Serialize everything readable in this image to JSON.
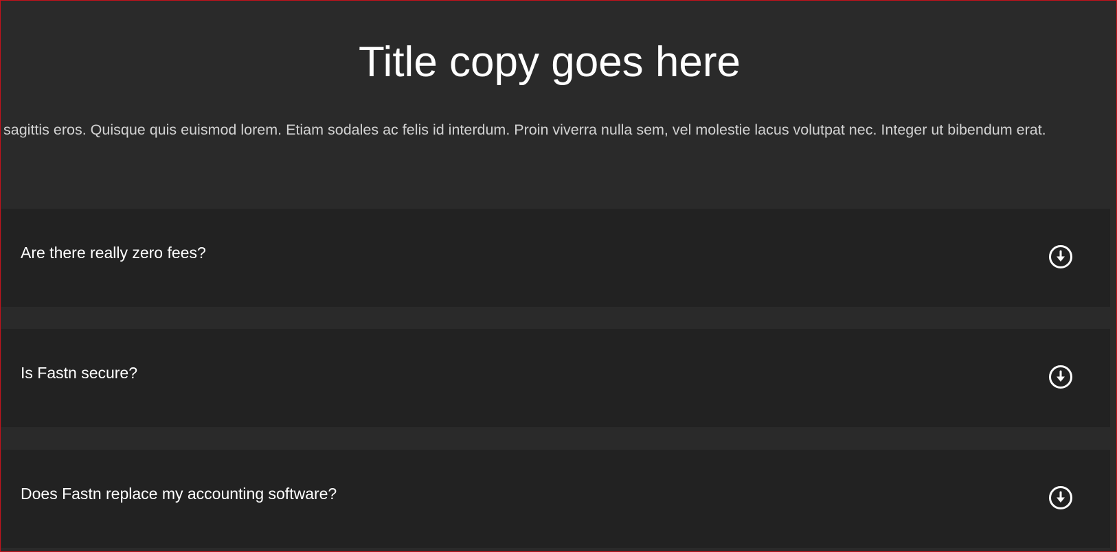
{
  "header": {
    "title": "Title copy goes here",
    "intro": "sagittis eros. Quisque quis euismod lorem. Etiam sodales ac felis id interdum. Proin viverra nulla sem, vel molestie lacus volutpat nec. Integer ut bibendum erat."
  },
  "faq": {
    "items": [
      {
        "question": "Are there really zero fees?",
        "icon": "arrow-down-circle-icon"
      },
      {
        "question": "Is Fastn secure?",
        "icon": "arrow-down-circle-icon"
      },
      {
        "question": "Does Fastn replace my accounting software?",
        "icon": "arrow-down-circle-icon"
      }
    ]
  },
  "colors": {
    "background": "#2a2a2a",
    "item_background": "#222222",
    "text": "#ffffff",
    "body_text": "#d2d2d2",
    "frame_border": "#c4121b"
  }
}
